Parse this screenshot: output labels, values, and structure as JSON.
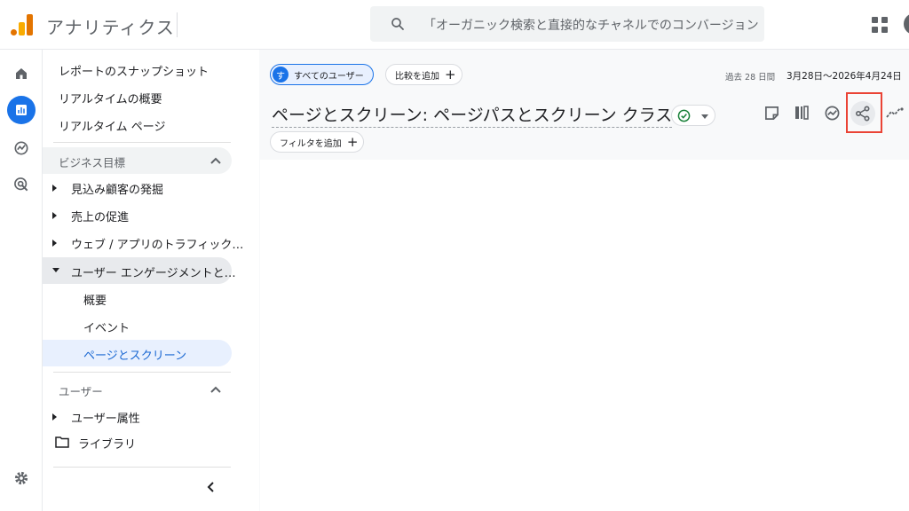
{
  "app": {
    "title": "アナリティクス"
  },
  "search": {
    "text": "「オーガニック検索と直接的なチャネルでのコンバージョン…"
  },
  "nav": {
    "top_items": [
      "レポートのスナップショット",
      "リアルタイムの概要",
      "リアルタイム ページ"
    ],
    "business_section": "ビジネス目標",
    "business_items": [
      "見込み顧客の発掘",
      "売上の促進",
      "ウェブ / アプリのトラフィック…",
      "ユーザー エンゲージメントと…"
    ],
    "engagement_subitems": [
      "概要",
      "イベント",
      "ページとスクリーン"
    ],
    "user_section": "ユーザー",
    "user_items": [
      "ユーザー属性"
    ],
    "library": "ライブラリ"
  },
  "main": {
    "users_chip": {
      "badge": "す",
      "label": "すべてのユーザー"
    },
    "compare_chip": "比較を追加",
    "date_range": {
      "prefix": "過去 28 日間",
      "range": "3月28日～2026年4月24日"
    },
    "page_title": "ページとスクリーン: ページパスとスクリーン クラス",
    "filter_chip": "フィルタを追加"
  },
  "icons": {
    "rail": [
      "home-icon",
      "reports-icon",
      "explore-icon",
      "advertising-icon",
      "settings-icon"
    ],
    "toolbar": [
      "customize-report-icon",
      "compare-icon",
      "insights-icon",
      "share-icon",
      "trend-icon"
    ]
  },
  "colors": {
    "accent": "#1a73e8",
    "highlight": "#ea4335",
    "logo_orange": "#e37400",
    "logo_yellow": "#f9ab00"
  }
}
